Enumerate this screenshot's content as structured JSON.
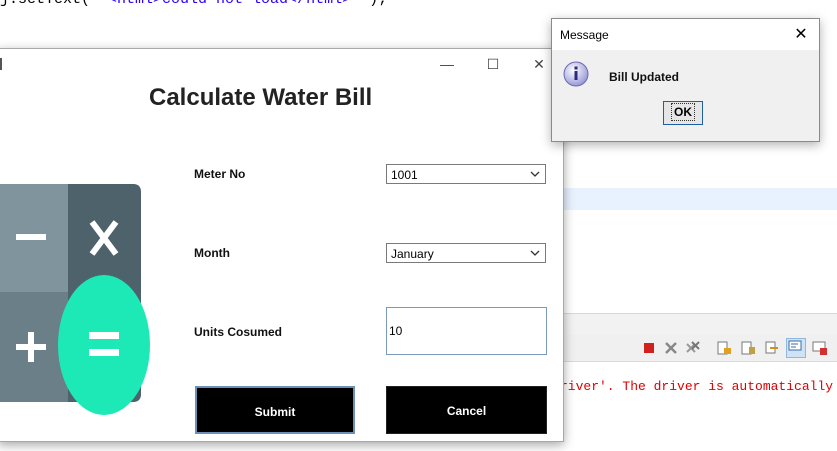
{
  "background_ide": {
    "code_prefix": "j.setText(",
    "code_string": "\"<html>could not load</html>\"",
    "code_suffix": ");",
    "console_text": "river'. The driver is automatically reg"
  },
  "main_window": {
    "title": "Calculate Water Bill",
    "controls": {
      "minimize": "—",
      "maximize": "☐",
      "close": "✕"
    },
    "form": {
      "meter_label": "Meter No",
      "meter_value": "1001",
      "month_label": "Month",
      "month_value": "January",
      "units_label": "Units Cosumed",
      "units_value": "10"
    },
    "buttons": {
      "submit": "Submit",
      "cancel": "Cancel"
    }
  },
  "message_dialog": {
    "title": "Message",
    "message": "Bill Updated",
    "ok_label": "OK",
    "icon": "info-icon"
  },
  "colors": {
    "calculator_dark": "#4d626b",
    "calculator_light": "#7f949c",
    "equals_accent": "#1de9b6",
    "button_bg": "#000000",
    "error_text": "#e00000"
  }
}
